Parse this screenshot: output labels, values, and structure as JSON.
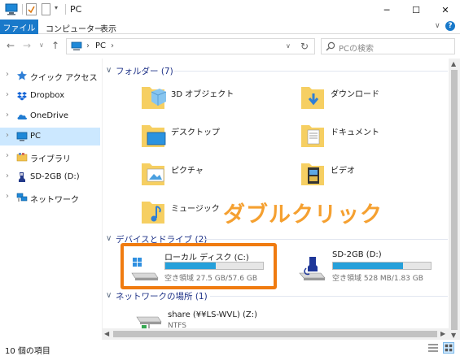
{
  "window": {
    "title": "PC",
    "minimize_glyph": "─",
    "maximize_glyph": "☐",
    "close_glyph": "✕"
  },
  "ribbon": {
    "file_tab": "ファイル",
    "tabs": [
      "コンピューター",
      "表示"
    ],
    "collapse_glyph": "∨",
    "help_glyph": "?"
  },
  "nav": {
    "back_glyph": "←",
    "forward_glyph": "→",
    "history_glyph": "∨",
    "up_glyph": "↑",
    "address": {
      "separator": "›",
      "location": "PC",
      "dropdown_glyph": "∨",
      "refresh_glyph": "↻"
    },
    "search_placeholder": "PCの検索"
  },
  "sidebar": {
    "expand_glyph": "›",
    "items": [
      {
        "label": "クイック アクセス",
        "icon": "star-icon"
      },
      {
        "label": "Dropbox",
        "icon": "dropbox-icon"
      },
      {
        "label": "OneDrive",
        "icon": "cloud-icon"
      },
      {
        "label": "PC",
        "icon": "computer-icon",
        "selected": true
      },
      {
        "label": "ライブラリ",
        "icon": "library-icon"
      },
      {
        "label": "SD-2GB (D:)",
        "icon": "sd-card-icon"
      },
      {
        "label": "ネットワーク",
        "icon": "network-icon"
      }
    ]
  },
  "groups": {
    "collapse_glyph": "∨",
    "folders": "フォルダー (7)",
    "drives": "デバイスとドライブ (2)",
    "network": "ネットワークの場所 (1)"
  },
  "folders": [
    {
      "label": "3D オブジェクト",
      "icon": "3d-objects-folder-icon"
    },
    {
      "label": "ダウンロード",
      "icon": "downloads-folder-icon"
    },
    {
      "label": "デスクトップ",
      "icon": "desktop-folder-icon"
    },
    {
      "label": "ドキュメント",
      "icon": "documents-folder-icon"
    },
    {
      "label": "ピクチャ",
      "icon": "pictures-folder-icon"
    },
    {
      "label": "ビデオ",
      "icon": "videos-folder-icon"
    },
    {
      "label": "ミュージック",
      "icon": "music-folder-icon"
    }
  ],
  "drives": [
    {
      "name": "ローカル ディスク (C:)",
      "free_text": "空き領域 27.5 GB/57.6 GB",
      "used_fraction": 0.52,
      "icon": "local-disk-icon",
      "highlighted": true
    },
    {
      "name": "SD-2GB (D:)",
      "free_text": "空き領域 528 MB/1.83 GB",
      "used_fraction": 0.72,
      "icon": "sd-card-drive-icon",
      "highlighted": false
    }
  ],
  "network_locations": [
    {
      "name": "share (¥¥LS-WVL) (Z:)",
      "fs": "NTFS",
      "icon": "network-drive-icon"
    }
  ],
  "annotation": "ダブルクリック",
  "scrollbars": {
    "up": "▲",
    "down": "▼",
    "left": "◀",
    "right": "▶"
  },
  "status": {
    "item_count": "10 個の項目"
  },
  "colors": {
    "accent": "#1979ca",
    "selection": "#cce8ff",
    "drive_bar": "#26a0da",
    "highlight_box": "#f07b10",
    "annotation": "#f5a030",
    "group_header": "#1e3287"
  }
}
